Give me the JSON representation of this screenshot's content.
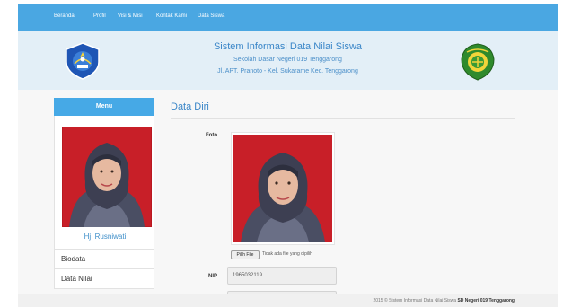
{
  "nav": {
    "items": [
      {
        "label": "Beranda"
      },
      {
        "label": "Profil"
      },
      {
        "label": "Visi & Misi"
      },
      {
        "label": "Kontak Kami"
      },
      {
        "label": "Data Siswa"
      }
    ]
  },
  "header": {
    "title": "Sistem Informasi Data Nilai Siswa",
    "school": "Sekolah Dasar Negeri 019 Tenggarong",
    "address": "Jl. APT. Pranoto - Kel. Sukarame Kec. Tenggarong"
  },
  "sidebar": {
    "menu_label": "Menu",
    "user_name": "Hj. Rusniwati",
    "items": [
      {
        "label": "Biodata"
      },
      {
        "label": "Data Nilai"
      }
    ]
  },
  "main": {
    "title": "Data Diri",
    "foto_label": "Foto",
    "file_button": "Pilih File",
    "file_status": "Tidak ada file yang dipilih",
    "nip_label": "NIP",
    "nip_value": "1965032119"
  },
  "footer": {
    "text": "2015 © Sistem Informasi Data Nilai Siswa",
    "bold": "SD Negeri 019 Tenggarong"
  },
  "colors": {
    "navbar": "#4aa7e2",
    "header_bg": "#e3eff7",
    "accent_text": "#3a86c8",
    "menu_bar": "#46a9e6"
  },
  "icons": {
    "left_logo": "tut-wuri-handayani-emblem",
    "right_logo": "kutai-kartanegara-regency-emblem"
  }
}
